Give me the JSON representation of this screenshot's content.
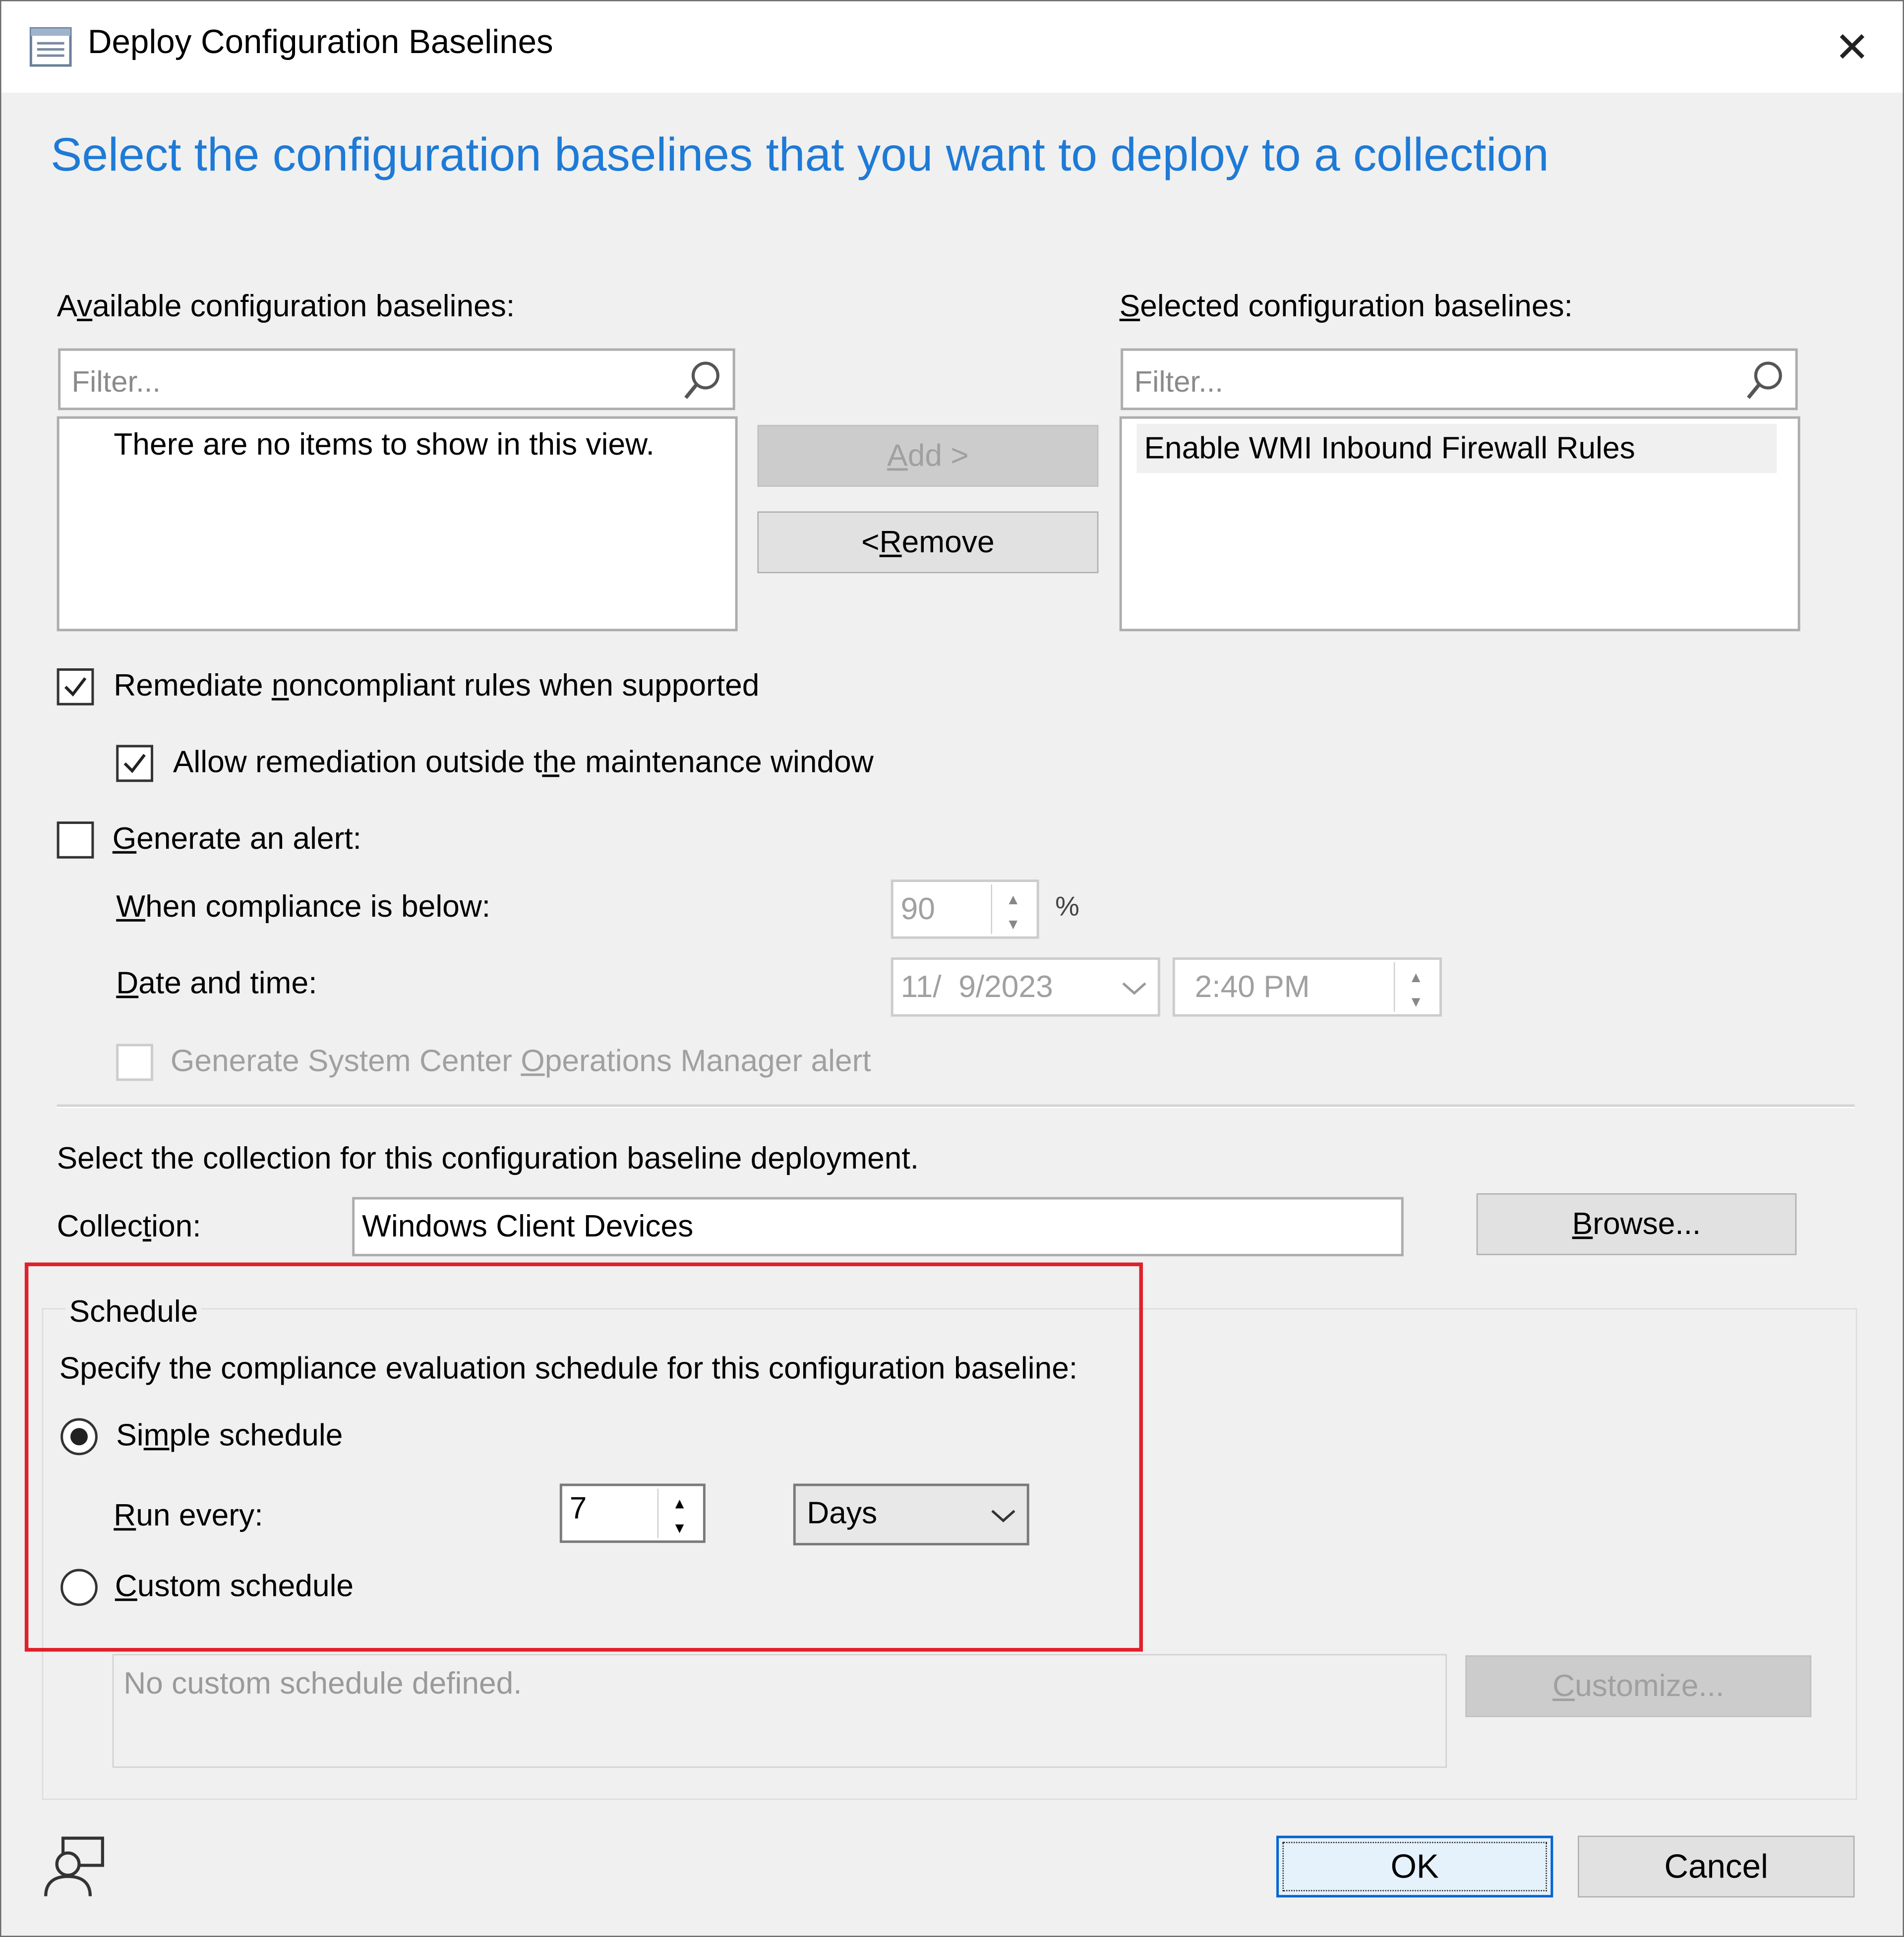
{
  "window": {
    "title": "Deploy Configuration Baselines",
    "close_glyph": "✕"
  },
  "heading": "Select the configuration baselines that you want to deploy to a collection",
  "available": {
    "label_pre": "A",
    "label_u": "v",
    "label_post": "ailable configuration baselines:",
    "filter_placeholder": "Filter...",
    "empty_text": "There are no items to show in this view."
  },
  "selected": {
    "label_u": "S",
    "label_post": "elected configuration baselines:",
    "filter_placeholder": "Filter...",
    "items": [
      "Enable WMI Inbound Firewall Rules"
    ]
  },
  "buttons": {
    "add_u": "A",
    "add_post": "dd >",
    "remove_pre": "< ",
    "remove_u": "R",
    "remove_post": "emove",
    "browse_u": "B",
    "browse_post": "rowse...",
    "customize_u": "C",
    "customize_post": "ustomize...",
    "ok": "OK",
    "cancel": "Cancel"
  },
  "options": {
    "remediate": {
      "checked": true,
      "pre": "Remediate ",
      "u": "n",
      "post": "oncompliant rules when supported"
    },
    "allow_outside": {
      "checked": true,
      "pre": "Allow remediation outside t",
      "u": "h",
      "post": "e maintenance window"
    },
    "generate_alert": {
      "checked": false,
      "u": "G",
      "post": "enerate an alert:"
    },
    "compliance_u": "W",
    "compliance_post": "hen compliance is below:",
    "compliance_value": "90",
    "percent": "%",
    "datetime_u": "D",
    "datetime_post": "ate and time:",
    "date_value": "11/  9/2023",
    "time_value": "2:40 PM",
    "scom": {
      "checked": false,
      "pre": "Generate System Center ",
      "u": "O",
      "post": "perations Manager alert"
    }
  },
  "collection": {
    "instruction": "Select the collection for this configuration baseline deployment.",
    "label_pre": "Collec",
    "label_u": "t",
    "label_post": "ion:",
    "value": "Windows Client Devices"
  },
  "schedule": {
    "legend": "Schedule",
    "instruction": "Specify the compliance evaluation schedule for this configuration baseline:",
    "simple": {
      "selected": true,
      "pre": "Si",
      "u": "m",
      "post": "ple schedule"
    },
    "run_every_u": "R",
    "run_every_post": "un every:",
    "run_every_value": "7",
    "unit": "Days",
    "custom": {
      "selected": false,
      "u": "C",
      "post": "ustom schedule"
    },
    "custom_text": "No custom schedule defined."
  },
  "colors": {
    "heading": "#1e7ad6",
    "highlight_box": "#e0202a",
    "ok_border": "#0063d1"
  }
}
